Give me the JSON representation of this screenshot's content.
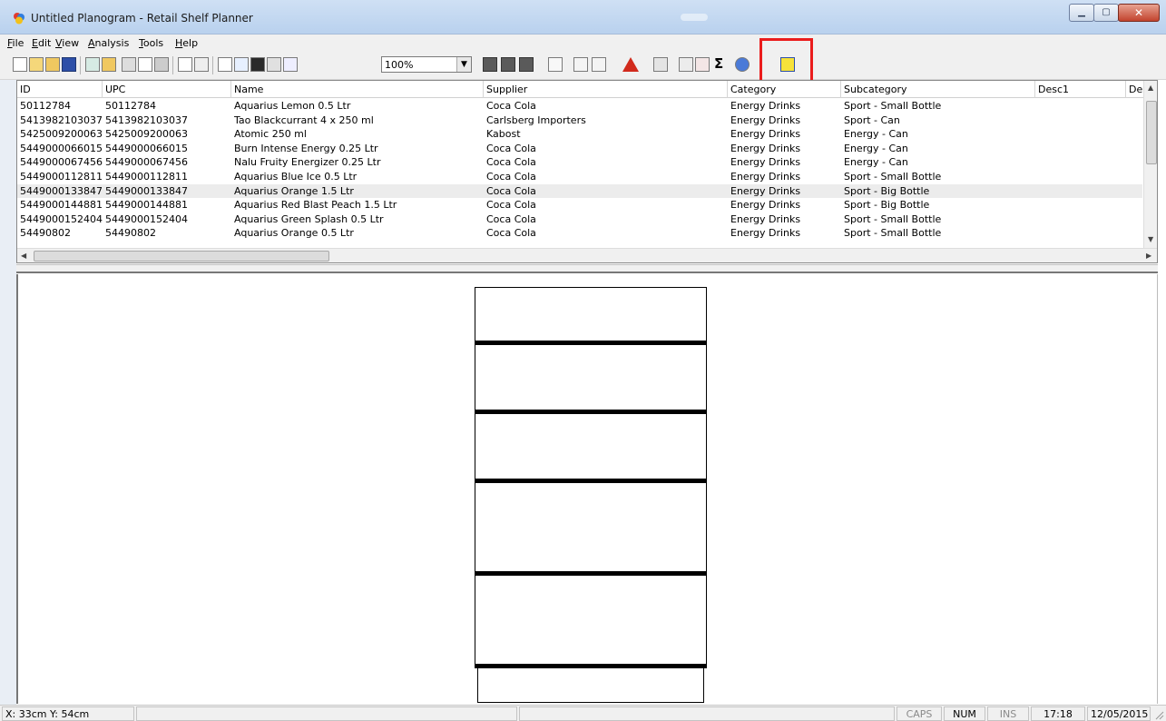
{
  "window": {
    "title": "Untitled Planogram - Retail Shelf Planner"
  },
  "menu": [
    {
      "label": "File",
      "underline": "F",
      "rest": "ile"
    },
    {
      "label": "Edit",
      "underline": "E",
      "rest": "dit"
    },
    {
      "label": "View",
      "underline": "V",
      "rest": "iew"
    },
    {
      "label": "Analysis",
      "underline": "A",
      "rest": "nalysis"
    },
    {
      "label": "Tools",
      "underline": "T",
      "rest": "ools"
    },
    {
      "label": "Help",
      "underline": "H",
      "rest": "elp"
    }
  ],
  "toolbar": {
    "zoom_value": "100%",
    "sigma": "Σ"
  },
  "table": {
    "columns": [
      "ID",
      "UPC",
      "Name",
      "Supplier",
      "Category",
      "Subcategory",
      "Desc1",
      "De"
    ],
    "rows": [
      [
        "50112784",
        "50112784",
        "Aquarius Lemon 0.5 Ltr",
        "Coca Cola",
        "Energy Drinks",
        "Sport - Small Bottle"
      ],
      [
        "5413982103037",
        "5413982103037",
        "Tao Blackcurrant 4 x 250 ml",
        "Carlsberg Importers",
        "Energy Drinks",
        "Sport - Can"
      ],
      [
        "5425009200063",
        "5425009200063",
        "Atomic 250 ml",
        "Kabost",
        "Energy Drinks",
        "Energy - Can"
      ],
      [
        "5449000066015",
        "5449000066015",
        "Burn Intense Energy 0.25 Ltr",
        "Coca Cola",
        "Energy Drinks",
        "Energy - Can"
      ],
      [
        "5449000067456",
        "5449000067456",
        "Nalu Fruity Energizer 0.25 Ltr",
        "Coca Cola",
        "Energy Drinks",
        "Energy - Can"
      ],
      [
        "5449000112811",
        "5449000112811",
        "Aquarius Blue Ice 0.5 Ltr",
        "Coca Cola",
        "Energy Drinks",
        "Sport - Small Bottle"
      ],
      [
        "5449000133847",
        "5449000133847",
        "Aquarius Orange 1.5 Ltr",
        "Coca Cola",
        "Energy Drinks",
        "Sport - Big Bottle"
      ],
      [
        "5449000144881",
        "5449000144881",
        "Aquarius Red Blast Peach 1.5 Ltr",
        "Coca Cola",
        "Energy Drinks",
        "Sport - Big Bottle"
      ],
      [
        "5449000152404",
        "5449000152404",
        "Aquarius Green Splash 0.5 Ltr",
        "Coca Cola",
        "Energy Drinks",
        "Sport - Small Bottle"
      ],
      [
        "54490802",
        "54490802",
        "Aquarius Orange 0.5 Ltr",
        "Coca Cola",
        "Energy Drinks",
        "Sport - Small Bottle"
      ]
    ],
    "selected_row_index": 6
  },
  "statusbar": {
    "coords": "X: 33cm  Y: 54cm",
    "caps": "CAPS",
    "num": "NUM",
    "ins": "INS",
    "time": "17:18",
    "date": "12/05/2015"
  },
  "colors": {
    "highlight": "#ea1c1c",
    "selected_row": "#ececec"
  }
}
